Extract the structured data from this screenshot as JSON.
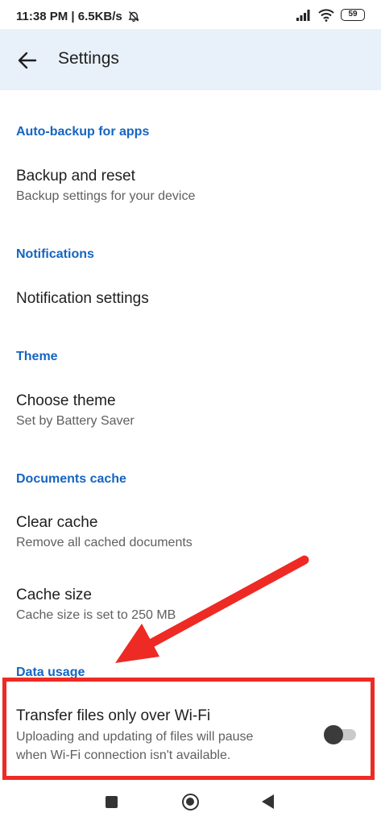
{
  "status_bar": {
    "time_info": "11:38 PM | 6.5KB/s",
    "battery_level": "59"
  },
  "app_bar": {
    "title": "Settings"
  },
  "sections": {
    "auto_backup": {
      "header": "Auto-backup for apps",
      "backup_title": "Backup and reset",
      "backup_summary": "Backup settings for your device"
    },
    "notifications": {
      "header": "Notifications",
      "notification_title": "Notification settings"
    },
    "theme": {
      "header": "Theme",
      "theme_title": "Choose theme",
      "theme_summary": "Set by Battery Saver"
    },
    "documents_cache": {
      "header": "Documents cache",
      "clear_title": "Clear cache",
      "clear_summary": "Remove all cached documents",
      "size_title": "Cache size",
      "size_summary": "Cache size is set to 250 MB"
    },
    "data_usage": {
      "header": "Data usage",
      "wifi_title": "Transfer files only over Wi-Fi",
      "wifi_summary_line1": "Uploading and updating of files will pause",
      "wifi_summary_line2": "when Wi-Fi connection isn't available.",
      "wifi_toggle_on": false
    }
  },
  "icons": {
    "back": "arrow-back-icon",
    "nav_recents": "square-icon",
    "nav_home": "circle-icon",
    "nav_back": "triangle-back-icon"
  },
  "colors": {
    "accent": "#1565c0",
    "app_bar_bg": "#e8f1f9",
    "annotation": "#ee2a24"
  }
}
